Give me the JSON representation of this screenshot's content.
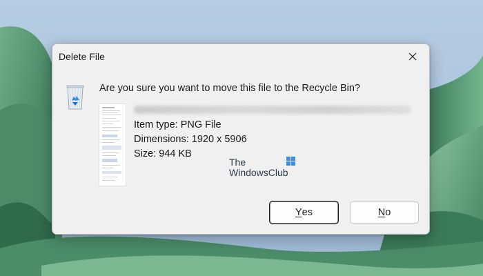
{
  "dialog": {
    "title": "Delete File",
    "question": "Are you sure you want to move this file to the Recycle Bin?",
    "item_type": "Item type: PNG File",
    "dimensions": "Dimensions: 1920 x 5906",
    "size": "Size: 944 KB"
  },
  "watermark": {
    "line1": "The",
    "line2": "WindowsClub"
  },
  "buttons": {
    "yes_mnemonic": "Y",
    "yes_rest": "es",
    "no_mnemonic": "N",
    "no_rest": "o"
  },
  "icons": {
    "close": "close-icon",
    "recycle_bin": "recycle-bin-icon",
    "file_thumbnail": "file-thumbnail",
    "watermark_logo": "windows-logo-icon"
  },
  "colors": {
    "wallpaper_green": "#4f8f6a",
    "wallpaper_sky": "#a9c3dd",
    "dialog_bg": "#f0f0f0"
  }
}
